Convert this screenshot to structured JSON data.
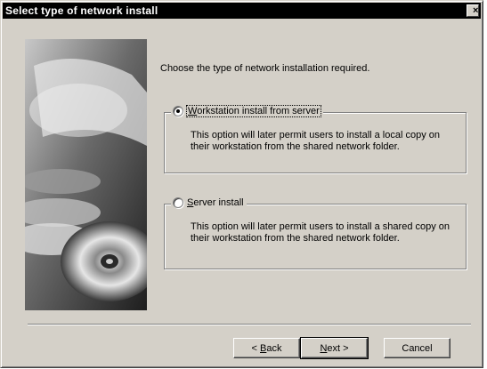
{
  "window": {
    "title": "Select type of network install",
    "close_glyph": "×"
  },
  "prompt": "Choose the type of network installation required.",
  "options": [
    {
      "label_mnemonic": "W",
      "label_rest": "orkstation install from server",
      "selected": true,
      "description": "This option will later permit users to install a local copy on their workstation from the shared network folder."
    },
    {
      "label_mnemonic": "S",
      "label_rest": "erver install",
      "selected": false,
      "description": "This option will later permit users to install a shared copy on their workstation from the shared network folder."
    }
  ],
  "buttons": {
    "back_prefix": "< ",
    "back_mnemonic": "B",
    "back_rest": "ack",
    "next_mnemonic": "N",
    "next_rest": "ext >",
    "cancel": "Cancel"
  },
  "colors": {
    "face": "#d4d0c8",
    "titlebar": "#000000",
    "title_text": "#ffffff"
  }
}
